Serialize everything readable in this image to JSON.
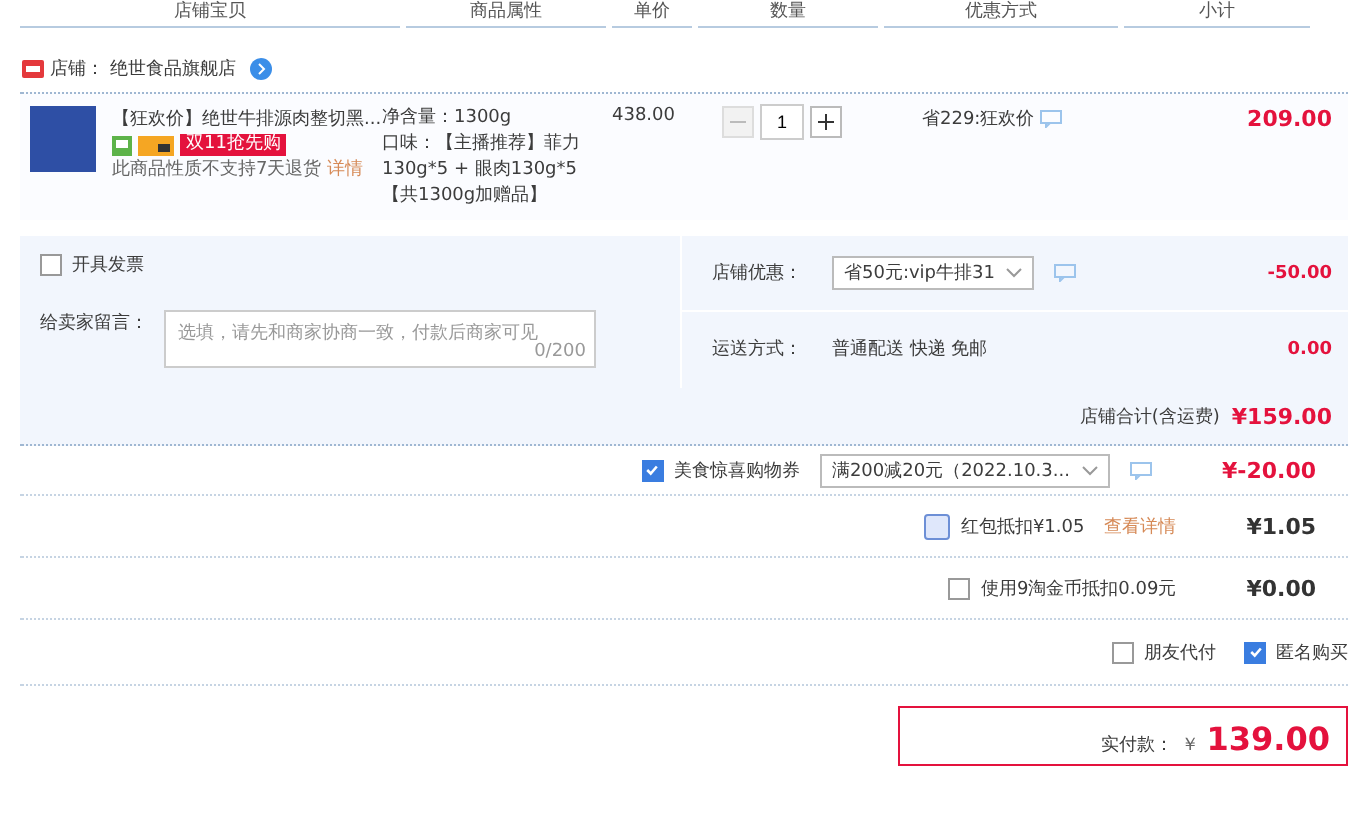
{
  "columns": [
    "店铺宝贝",
    "商品属性",
    "单价",
    "数量",
    "优惠方式",
    "小计"
  ],
  "shop": {
    "label": "店铺：",
    "name": "绝世食品旗舰店"
  },
  "item": {
    "title": "【狂欢价】绝世牛排源肉整切黑...",
    "badge": "双11抢先购",
    "notice": "此商品性质不支持7天退货",
    "notice_link": "详情",
    "attr_lines": [
      "净含量：1300g",
      "口味：【主播推荐】菲力130g*5 + 眼肉130g*5【共1300g加赠品】"
    ],
    "price": "438.00",
    "quantity": "1",
    "promo": "省229:狂欢价",
    "subtotal": "209.00"
  },
  "invoice": {
    "label": "开具发票",
    "checked": false
  },
  "message": {
    "label": "给卖家留言：",
    "placeholder": "选填，请先和商家协商一致，付款后商家可见",
    "counter": "0/200"
  },
  "store_discount": {
    "label": "店铺优惠：",
    "value": "省50元:vip牛排31",
    "amount": "-50.00"
  },
  "shipping": {
    "label": "运送方式：",
    "value": "普通配送 快递 免邮",
    "amount": "0.00"
  },
  "store_total": {
    "label": "店铺合计(含运费)",
    "amount": "¥159.00"
  },
  "coupon": {
    "label": "美食惊喜购物券",
    "checked": true,
    "value": "满200减20元（2022.10.3...",
    "amount": "¥-20.00"
  },
  "red_packet": {
    "label": "红包抵扣¥1.05",
    "checked": false,
    "link": "查看详情",
    "amount": "¥1.05"
  },
  "coins": {
    "label": "使用9淘金币抵扣0.09元",
    "checked": false,
    "amount": "¥0.00"
  },
  "options": [
    {
      "label": "朋友代付",
      "checked": false
    },
    {
      "label": "匿名购买",
      "checked": true
    }
  ],
  "pay": {
    "label": "实付款：",
    "currency": "￥",
    "amount": "139.00"
  }
}
